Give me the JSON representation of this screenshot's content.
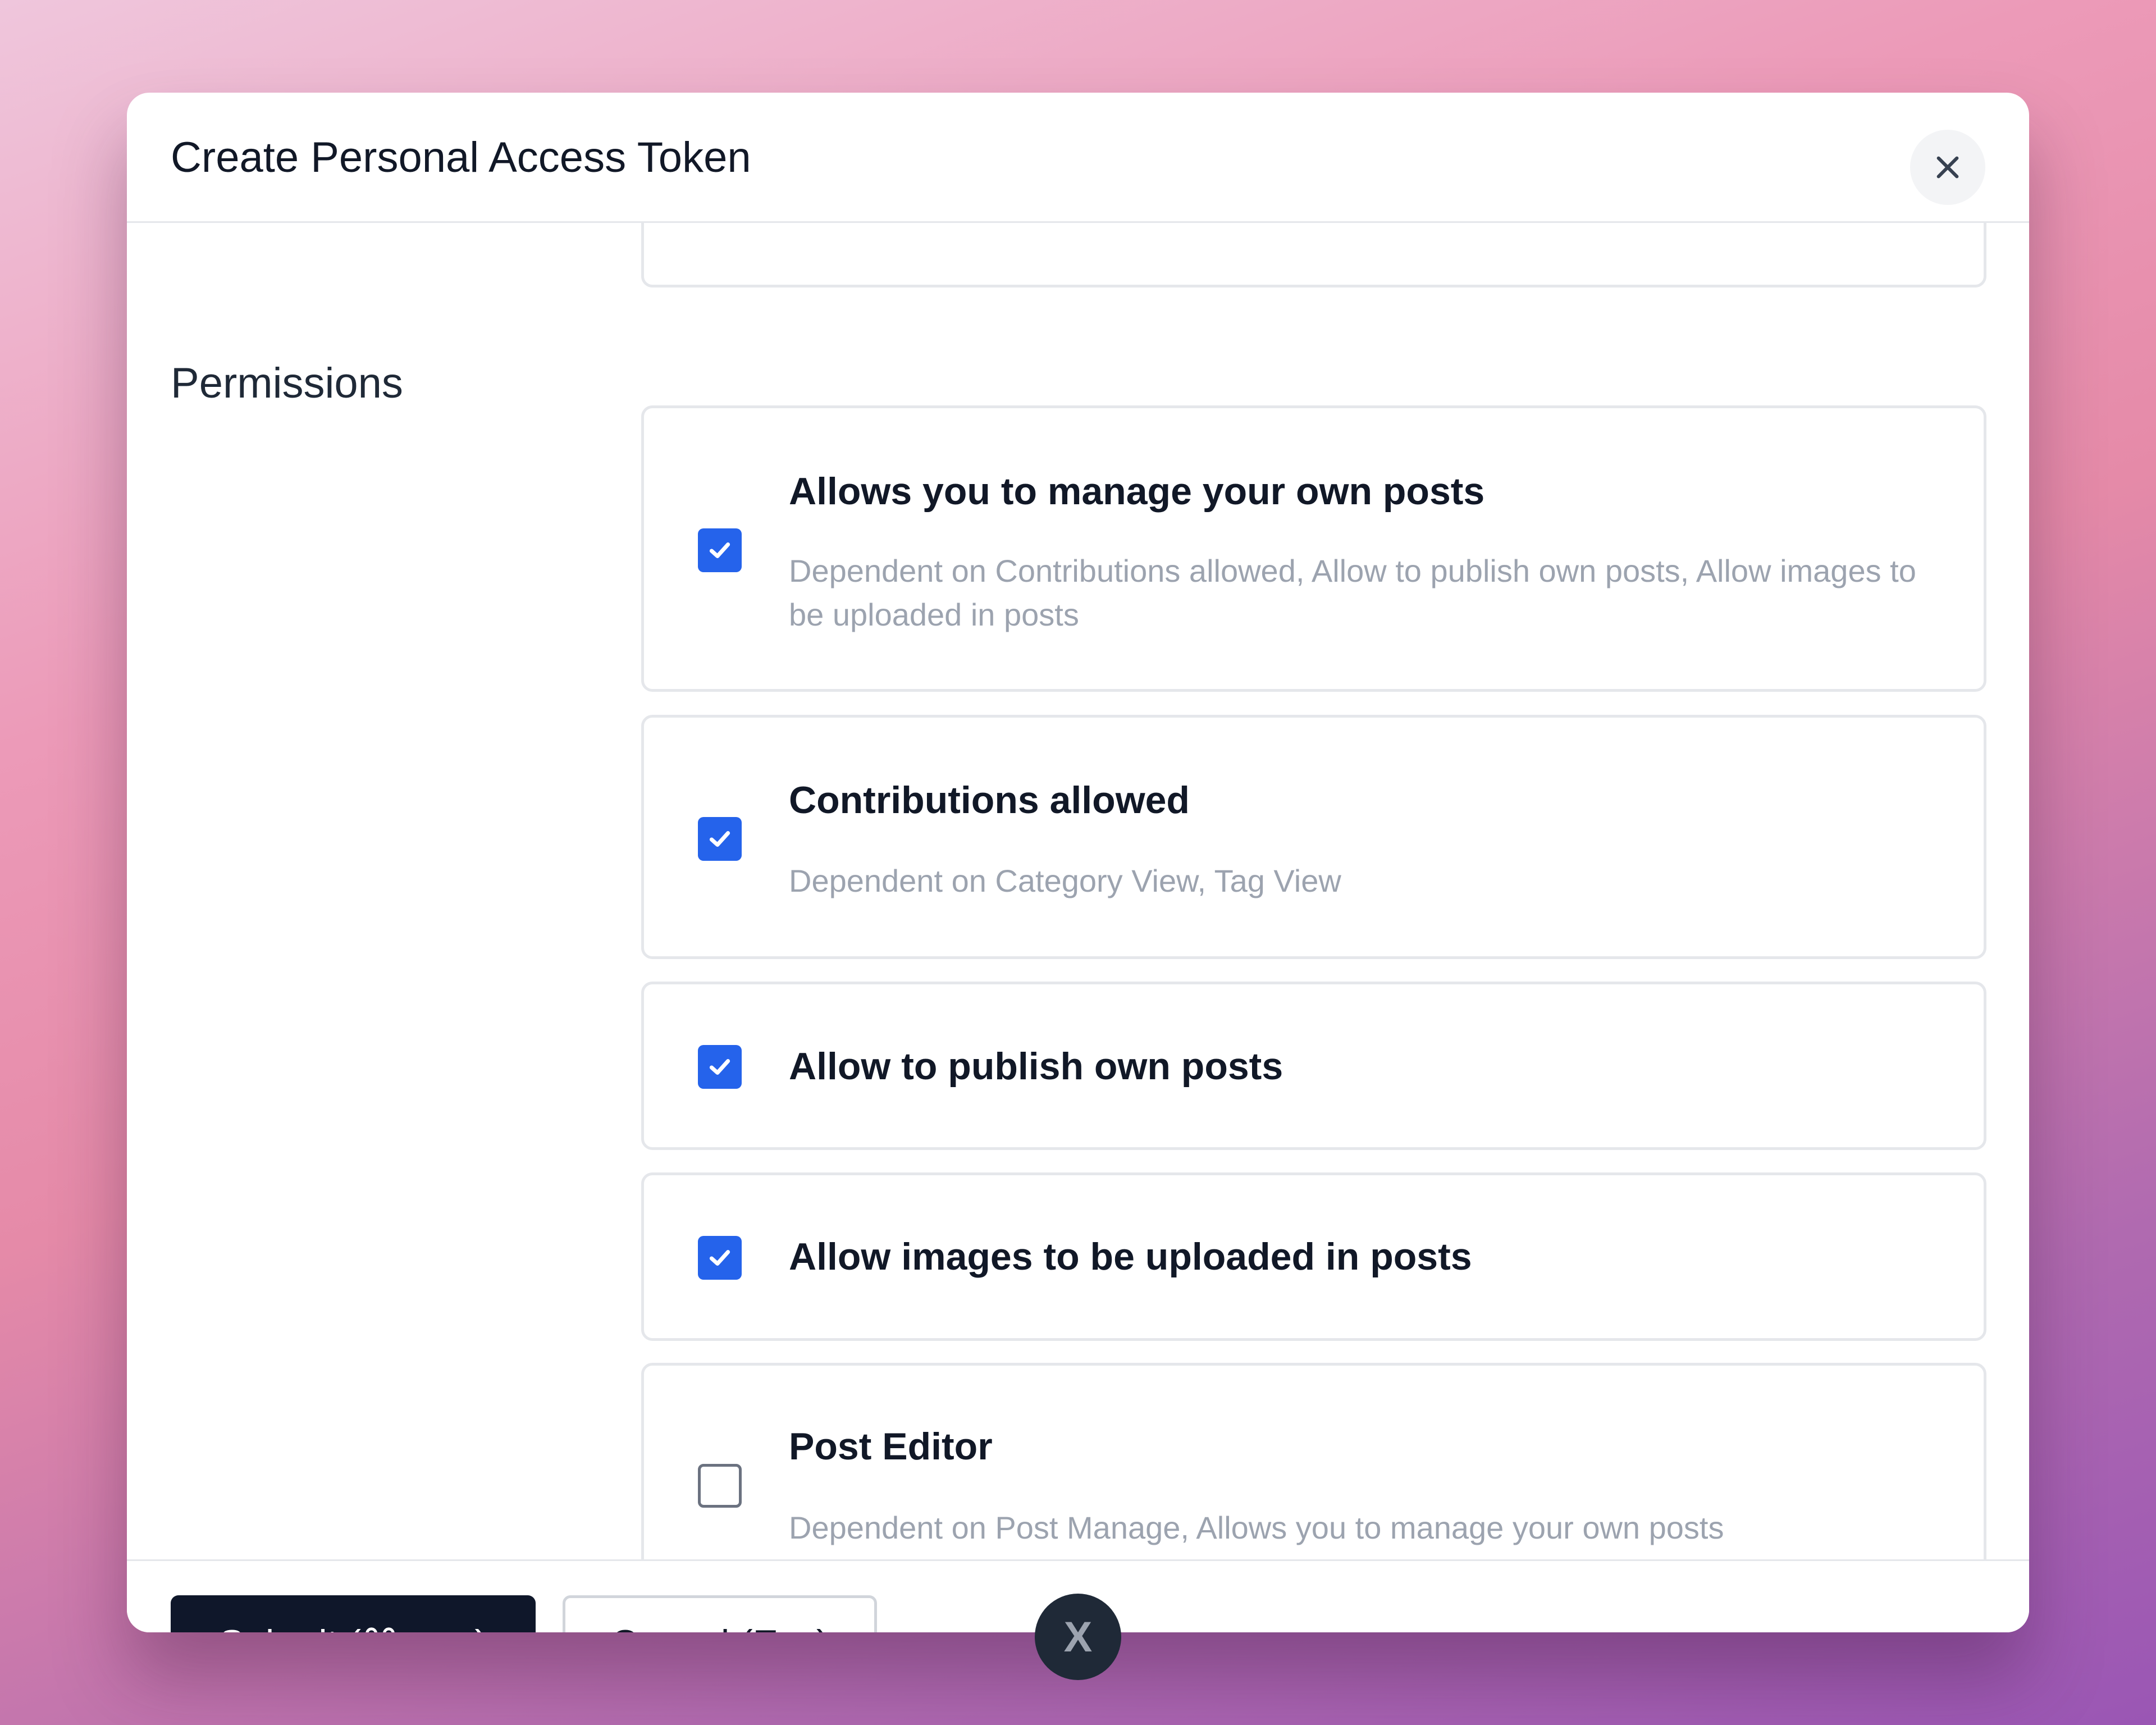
{
  "modal": {
    "title": "Create Personal Access Token",
    "close_icon": "close-icon"
  },
  "permissions": {
    "section_label": "Permissions",
    "items": [
      {
        "title": "",
        "description": "",
        "checked": null
      },
      {
        "title": "Allows you to manage your own posts",
        "description": "Dependent on Contributions allowed,  Allow to publish own posts,  Allow images to be uploaded in posts",
        "checked": true
      },
      {
        "title": "Contributions allowed",
        "description": "Dependent on Category View,  Tag View",
        "checked": true
      },
      {
        "title": "Allow to publish own posts",
        "description": "",
        "checked": true
      },
      {
        "title": "Allow images to be uploaded in posts",
        "description": "",
        "checked": true
      },
      {
        "title": "Post Editor",
        "description": "Dependent on Post Manage,  Allows you to manage your own posts",
        "checked": false
      }
    ]
  },
  "footer": {
    "submit_label": "Submit (⌘ + ↵)",
    "cancel_label": "Cancel (Esc)"
  },
  "floating_badge": {
    "label": "X"
  },
  "colors": {
    "accent": "#2563eb",
    "primary_button": "#0f172a",
    "muted_text": "#9ca3af"
  }
}
